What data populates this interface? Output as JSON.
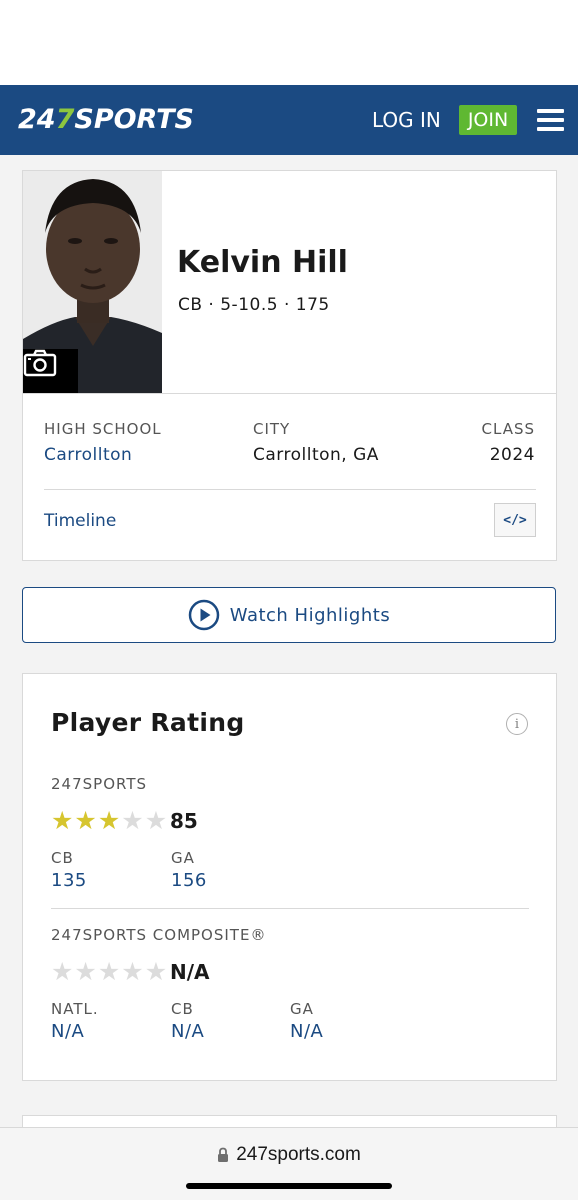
{
  "header": {
    "logo_num_a": "24",
    "logo_num_b": "7",
    "logo_word": "SPORTS",
    "login_label": "LOG IN",
    "join_label": "JOIN",
    "menu_icon": "hamburger-menu-icon",
    "brand_color": "#1b4a82",
    "accent_color": "#5fb832"
  },
  "player": {
    "name": "Kelvin Hill",
    "meta": "CB · 5-10.5 · 175",
    "photo_icon": "camera-icon"
  },
  "info": {
    "high_school_label": "HIGH SCHOOL",
    "high_school_value": "Carrollton",
    "city_label": "CITY",
    "city_value": "Carrollton, GA",
    "class_label": "CLASS",
    "class_value": "2024",
    "timeline_label": "Timeline",
    "embed_label": "</>"
  },
  "highlights": {
    "label": "Watch Highlights",
    "icon": "play-circle-icon"
  },
  "rating": {
    "title": "Player Rating",
    "info_icon": "info-icon",
    "sports247": {
      "label": "247SPORTS",
      "stars": 3,
      "max_stars": 5,
      "score": "85",
      "ranks": [
        {
          "label": "CB",
          "value": "135"
        },
        {
          "label": "GA",
          "value": "156"
        }
      ]
    },
    "composite": {
      "label": "247SPORTS COMPOSITE®",
      "stars": 0,
      "max_stars": 5,
      "score": "N/A",
      "ranks": [
        {
          "label": "NATL.",
          "value": "N/A"
        },
        {
          "label": "CB",
          "value": "N/A"
        },
        {
          "label": "GA",
          "value": "N/A"
        }
      ]
    },
    "star_on_color": "#d6c52f",
    "star_off_color": "#dcdcdc"
  },
  "browser": {
    "url": "247sports.com",
    "lock_icon": "lock-icon"
  }
}
